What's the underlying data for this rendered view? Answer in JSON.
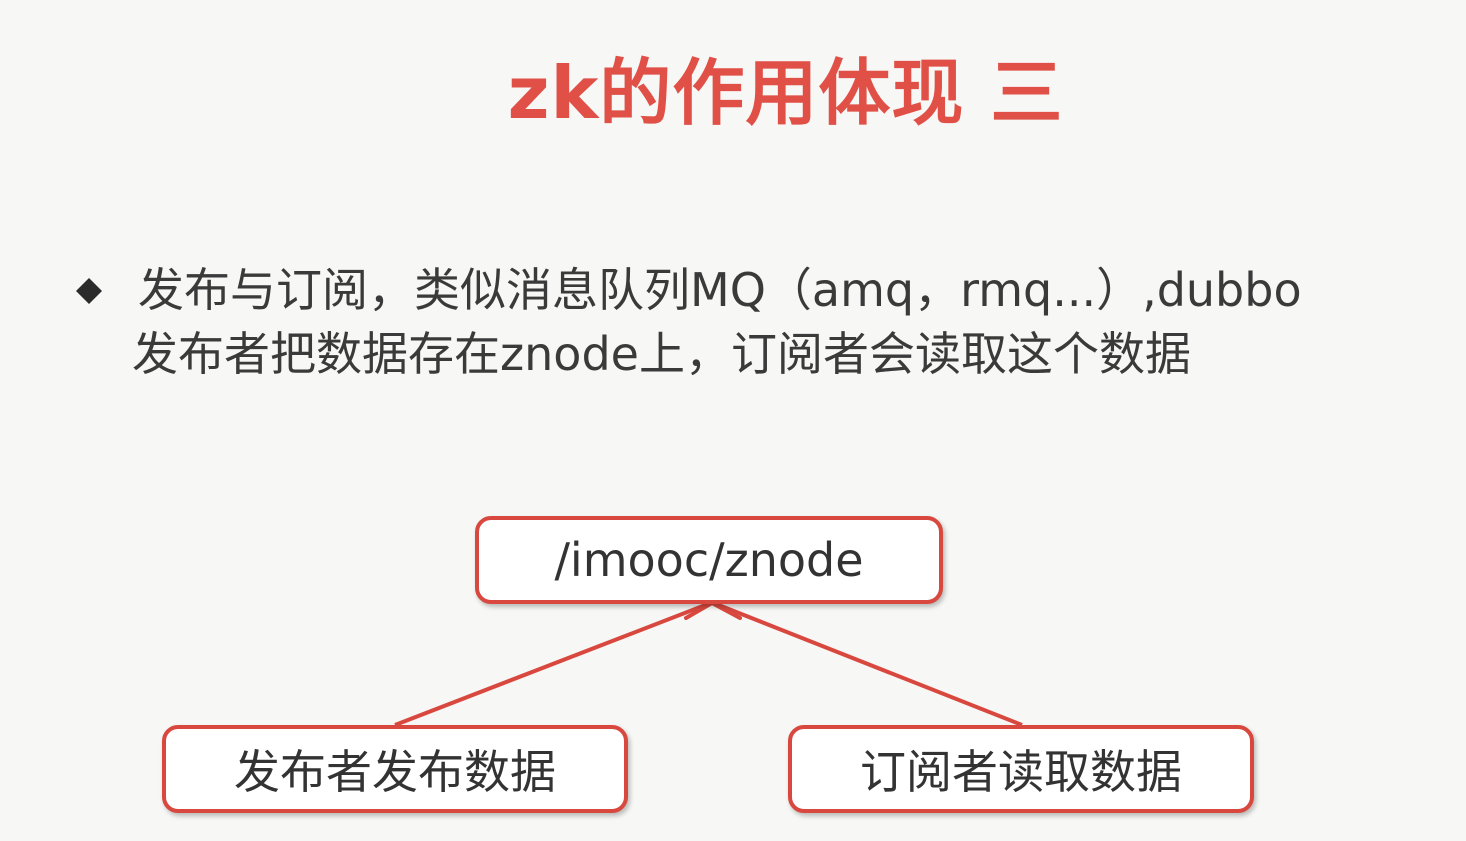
{
  "title": "zk的作用体现 三",
  "bullet": {
    "marker_icon": "diamond-bullet-icon",
    "line1": "发布与订阅，类似消息队列MQ（amq，rmq...）,dubbo",
    "line2": "发布者把数据存在znode上，订阅者会读取这个数据"
  },
  "diagram": {
    "nodes": {
      "znode": "/imooc/znode",
      "publisher": "发布者发布数据",
      "subscriber": "订阅者读取数据"
    },
    "edges": [
      {
        "from": "publisher",
        "to": "znode"
      },
      {
        "from": "subscriber",
        "to": "znode"
      }
    ],
    "colors": {
      "accent": "#e05047",
      "border": "#d9483f",
      "text": "#333333"
    }
  }
}
